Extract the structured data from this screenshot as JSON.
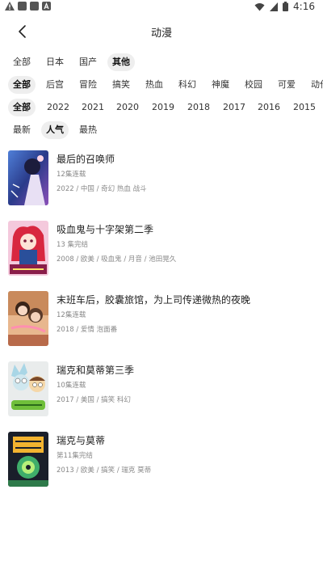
{
  "status_bar": {
    "time": "4:16"
  },
  "header": {
    "title": "动漫"
  },
  "filters": {
    "region": [
      "全部",
      "日本",
      "国产",
      "其他"
    ],
    "genre": [
      "全部",
      "后宫",
      "冒险",
      "搞笑",
      "热血",
      "科幻",
      "神魔",
      "校园",
      "可爱",
      "动作"
    ],
    "year": [
      "全部",
      "2022",
      "2021",
      "2020",
      "2019",
      "2018",
      "2017",
      "2016",
      "2015"
    ],
    "sort": [
      "最新",
      "人气",
      "最热"
    ]
  },
  "items": [
    {
      "title": "最后的召唤师",
      "status": "12集连载",
      "meta": "2022 / 中国 / 奇幻 热血 战斗"
    },
    {
      "title": "吸血鬼与十字架第二季",
      "status": "13 集完结",
      "meta": "2008 / 欧美 / 吸血鬼 / 月音 / 池田晃久"
    },
    {
      "title": "末班车后，胶囊旅馆，为上司传递微热的夜晚",
      "status": "12集连载",
      "meta": "2018 / 爱情 泡面番"
    },
    {
      "title": "瑞克和莫蒂第三季",
      "status": "10集连载",
      "meta": "2017 / 美国 / 搞笑 科幻"
    },
    {
      "title": "瑞克与莫蒂",
      "status": "第11集完结",
      "meta": "2013 / 欧美 / 搞笑 / 瑞克 莫蒂"
    }
  ],
  "colors": {
    "selected_chip_bg": "#eeeeee",
    "text": "#222222",
    "meta_text": "#888888"
  }
}
